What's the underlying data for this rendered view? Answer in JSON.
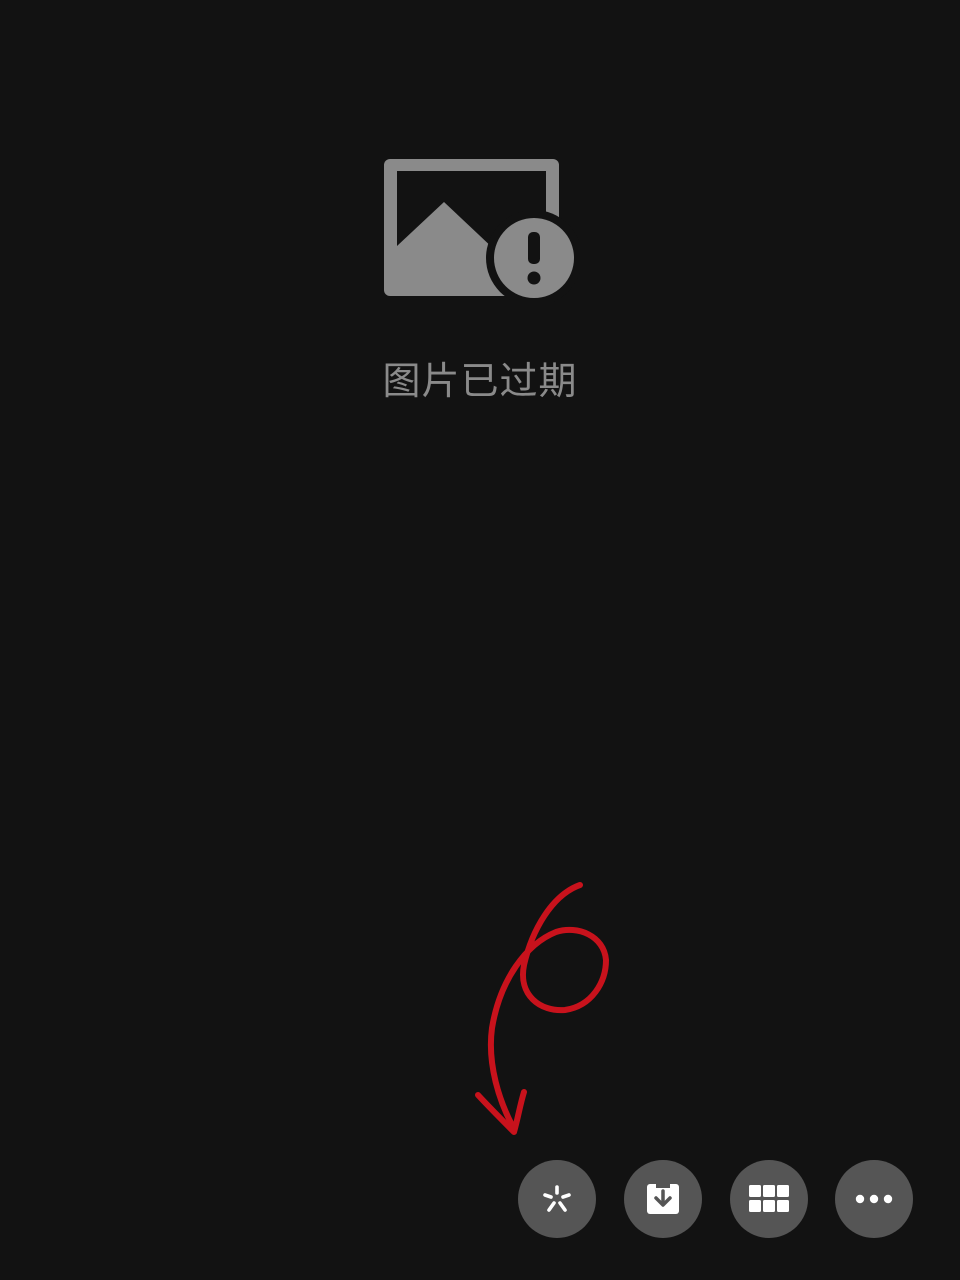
{
  "status": {
    "message": "图片已过期",
    "icon": "image-expired-icon"
  },
  "annotation": {
    "number": "6",
    "color": "#c8121c"
  },
  "toolbar": {
    "buttons": [
      {
        "name": "scan-button",
        "icon": "scan-sparkle-icon"
      },
      {
        "name": "download-button",
        "icon": "download-icon"
      },
      {
        "name": "grid-button",
        "icon": "grid-icon"
      },
      {
        "name": "more-button",
        "icon": "more-dots-icon"
      }
    ],
    "button_color": "#555555",
    "icon_color": "#ffffff"
  },
  "colors": {
    "background": "#121212",
    "muted": "#8a8a8a"
  }
}
